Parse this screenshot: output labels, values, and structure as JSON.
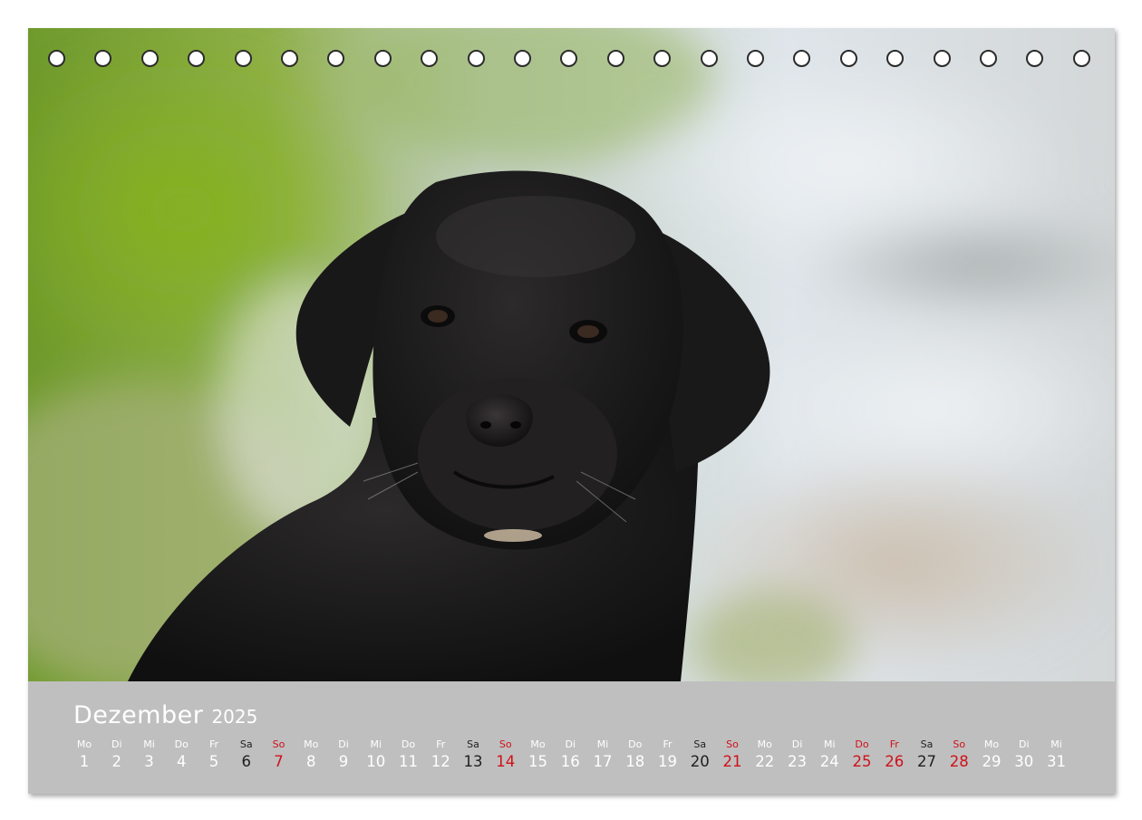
{
  "calendar": {
    "month": "Dezember",
    "year": "2025",
    "colors": {
      "weekday": "#ffffff",
      "saturday": "#1f1f1f",
      "holiday_sunday": "#d0101a",
      "strip": "#bfbfbf"
    },
    "days": [
      {
        "wd": "Mo",
        "n": "1",
        "kind": "normal"
      },
      {
        "wd": "Di",
        "n": "2",
        "kind": "normal"
      },
      {
        "wd": "Mi",
        "n": "3",
        "kind": "normal"
      },
      {
        "wd": "Do",
        "n": "4",
        "kind": "normal"
      },
      {
        "wd": "Fr",
        "n": "5",
        "kind": "normal"
      },
      {
        "wd": "Sa",
        "n": "6",
        "kind": "sat"
      },
      {
        "wd": "So",
        "n": "7",
        "kind": "red"
      },
      {
        "wd": "Mo",
        "n": "8",
        "kind": "normal"
      },
      {
        "wd": "Di",
        "n": "9",
        "kind": "normal"
      },
      {
        "wd": "Mi",
        "n": "10",
        "kind": "normal"
      },
      {
        "wd": "Do",
        "n": "11",
        "kind": "normal"
      },
      {
        "wd": "Fr",
        "n": "12",
        "kind": "normal"
      },
      {
        "wd": "Sa",
        "n": "13",
        "kind": "sat"
      },
      {
        "wd": "So",
        "n": "14",
        "kind": "red"
      },
      {
        "wd": "Mo",
        "n": "15",
        "kind": "normal"
      },
      {
        "wd": "Di",
        "n": "16",
        "kind": "normal"
      },
      {
        "wd": "Mi",
        "n": "17",
        "kind": "normal"
      },
      {
        "wd": "Do",
        "n": "18",
        "kind": "normal"
      },
      {
        "wd": "Fr",
        "n": "19",
        "kind": "normal"
      },
      {
        "wd": "Sa",
        "n": "20",
        "kind": "sat"
      },
      {
        "wd": "So",
        "n": "21",
        "kind": "red"
      },
      {
        "wd": "Mo",
        "n": "22",
        "kind": "normal"
      },
      {
        "wd": "Di",
        "n": "23",
        "kind": "normal"
      },
      {
        "wd": "Mi",
        "n": "24",
        "kind": "normal"
      },
      {
        "wd": "Do",
        "n": "25",
        "kind": "red"
      },
      {
        "wd": "Fr",
        "n": "26",
        "kind": "red"
      },
      {
        "wd": "Sa",
        "n": "27",
        "kind": "sat"
      },
      {
        "wd": "So",
        "n": "28",
        "kind": "red"
      },
      {
        "wd": "Mo",
        "n": "29",
        "kind": "normal"
      },
      {
        "wd": "Di",
        "n": "30",
        "kind": "normal"
      },
      {
        "wd": "Mi",
        "n": "31",
        "kind": "normal"
      }
    ]
  },
  "photo": {
    "subject": "black-labrador-puppy-photo"
  },
  "binding": {
    "hole_count": 23
  }
}
